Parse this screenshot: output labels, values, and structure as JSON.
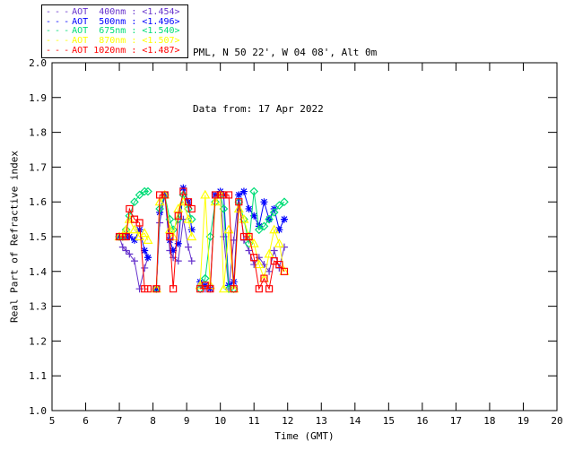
{
  "header": {
    "site_line": "PML, N 50 22', W 04 08', Alt 0m",
    "date_line": "Data from: 17 Apr 2022"
  },
  "legend": {
    "dash": "- - -"
  },
  "colors": {
    "background": "#FFFFFF",
    "axis": "#000000",
    "text": "#000000"
  },
  "chart_data": {
    "type": "line",
    "title": "",
    "xlabel": "Time (GMT)",
    "ylabel": "Real Part of Refractive index",
    "xlim": [
      5,
      20
    ],
    "ylim": [
      1.0,
      2.0
    ],
    "xticks": [
      5,
      6,
      7,
      8,
      9,
      10,
      11,
      12,
      13,
      14,
      15,
      16,
      17,
      18,
      19,
      20
    ],
    "yticks": [
      1.0,
      1.1,
      1.2,
      1.3,
      1.4,
      1.5,
      1.6,
      1.7,
      1.8,
      1.9,
      2.0
    ],
    "grid": false,
    "legend_position": "top-left-outside",
    "gap_break_hours": 0.2,
    "x": [
      7.0,
      7.1,
      7.2,
      7.3,
      7.45,
      7.6,
      7.75,
      7.85,
      8.1,
      8.2,
      8.35,
      8.5,
      8.6,
      8.75,
      8.9,
      9.05,
      9.15,
      9.4,
      9.55,
      9.7,
      9.85,
      10.0,
      10.1,
      10.25,
      10.4,
      10.55,
      10.7,
      10.85,
      11.0,
      11.15,
      11.3,
      11.45,
      11.6,
      11.75,
      11.9
    ],
    "series": [
      {
        "label": "AOT  400nm : <1.454>",
        "wavelength": "400nm",
        "mean": 1.454,
        "color": "#6633CC",
        "marker": "plus",
        "values": [
          1.5,
          1.47,
          1.46,
          1.45,
          1.43,
          1.35,
          1.41,
          1.44,
          1.35,
          1.54,
          1.62,
          1.46,
          1.44,
          1.43,
          1.55,
          1.47,
          1.43,
          1.36,
          1.35,
          1.36,
          1.62,
          1.62,
          1.5,
          1.35,
          1.49,
          1.62,
          1.49,
          1.46,
          1.42,
          1.44,
          1.42,
          1.4,
          1.46,
          1.41,
          1.47
        ]
      },
      {
        "label": "AOT  500nm : <1.496>",
        "wavelength": "500nm",
        "mean": 1.496,
        "color": "#0000FF",
        "marker": "asterisk",
        "values": [
          1.5,
          1.5,
          1.5,
          1.5,
          1.49,
          1.52,
          1.46,
          1.44,
          1.35,
          1.57,
          1.62,
          1.49,
          1.46,
          1.48,
          1.64,
          1.6,
          1.52,
          1.37,
          1.36,
          1.35,
          1.62,
          1.63,
          1.62,
          1.36,
          1.37,
          1.62,
          1.63,
          1.58,
          1.56,
          1.53,
          1.6,
          1.55,
          1.58,
          1.52,
          1.55
        ]
      },
      {
        "label": "AOT  675nm : <1.540>",
        "wavelength": "675nm",
        "mean": 1.54,
        "color": "#00DD77",
        "marker": "diamond",
        "values": [
          1.5,
          1.5,
          1.52,
          1.56,
          1.6,
          1.62,
          1.63,
          1.63,
          1.35,
          1.58,
          1.62,
          1.55,
          1.52,
          1.55,
          1.62,
          1.58,
          1.55,
          1.35,
          1.38,
          1.5,
          1.6,
          1.62,
          1.58,
          1.35,
          1.35,
          1.6,
          1.55,
          1.48,
          1.63,
          1.52,
          1.53,
          1.55,
          1.57,
          1.59,
          1.6
        ]
      },
      {
        "label": "AOT  870nm : <1.507>",
        "wavelength": "870nm",
        "mean": 1.507,
        "color": "#FFFF00",
        "marker": "triangle",
        "values": [
          1.5,
          1.5,
          1.52,
          1.55,
          1.52,
          1.5,
          1.51,
          1.49,
          1.35,
          1.6,
          1.62,
          1.52,
          1.5,
          1.58,
          1.6,
          1.55,
          1.5,
          1.36,
          1.62,
          1.36,
          1.6,
          1.62,
          1.35,
          1.52,
          1.35,
          1.58,
          1.55,
          1.5,
          1.48,
          1.42,
          1.38,
          1.45,
          1.52,
          1.48,
          1.4
        ]
      },
      {
        "label": "AOT 1020nm : <1.487>",
        "wavelength": "1020nm",
        "mean": 1.487,
        "color": "#FF0000",
        "marker": "square",
        "values": [
          1.5,
          1.5,
          1.5,
          1.58,
          1.55,
          1.54,
          1.35,
          1.35,
          1.35,
          1.62,
          1.62,
          1.5,
          1.35,
          1.56,
          1.63,
          1.6,
          1.58,
          1.35,
          1.36,
          1.35,
          1.62,
          1.62,
          1.62,
          1.62,
          1.35,
          1.6,
          1.5,
          1.5,
          1.44,
          1.35,
          1.38,
          1.35,
          1.43,
          1.42,
          1.4
        ]
      }
    ]
  }
}
